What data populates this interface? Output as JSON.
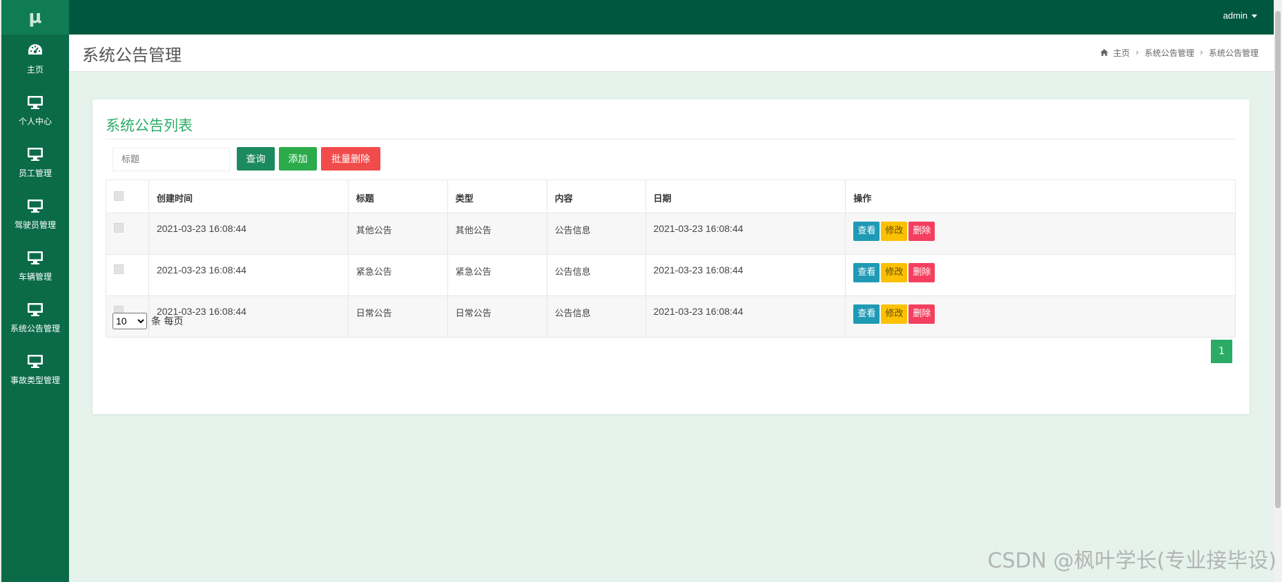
{
  "brand": {
    "logo_text": "μ"
  },
  "topbar": {
    "user": "admin"
  },
  "sidebar": {
    "items": [
      {
        "label": "主页",
        "icon": "dashboard-icon"
      },
      {
        "label": "个人中心",
        "icon": "monitor-icon"
      },
      {
        "label": "员工管理",
        "icon": "monitor-icon"
      },
      {
        "label": "驾驶员管理",
        "icon": "monitor-icon"
      },
      {
        "label": "车辆管理",
        "icon": "monitor-icon"
      },
      {
        "label": "系统公告管理",
        "icon": "monitor-icon"
      },
      {
        "label": "事故类型管理",
        "icon": "monitor-icon"
      }
    ]
  },
  "header": {
    "title": "系统公告管理",
    "breadcrumb": [
      "主页",
      "系统公告管理",
      "系统公告管理"
    ]
  },
  "card": {
    "title": "系统公告列表",
    "search": {
      "placeholder": "标题",
      "value": ""
    },
    "buttons": {
      "query": "查询",
      "add": "添加",
      "batch_delete": "批量删除"
    },
    "table": {
      "headers": [
        "创建时间",
        "标题",
        "类型",
        "内容",
        "日期",
        "操作"
      ],
      "rows": [
        {
          "created": "2021-03-23 16:08:44",
          "title": "其他公告",
          "type": "其他公告",
          "content": "公告信息",
          "date": "2021-03-23 16:08:44"
        },
        {
          "created": "2021-03-23 16:08:44",
          "title": "紧急公告",
          "type": "紧急公告",
          "content": "公告信息",
          "date": "2021-03-23 16:08:44"
        },
        {
          "created": "2021-03-23 16:08:44",
          "title": "日常公告",
          "type": "日常公告",
          "content": "公告信息",
          "date": "2021-03-23 16:08:44"
        }
      ],
      "ops": {
        "view": "查看",
        "edit": "修改",
        "delete": "删除"
      }
    },
    "pager": {
      "size": "10",
      "size_options": [
        "10"
      ],
      "unit_text": "条 每页",
      "current_page": "1"
    }
  },
  "watermark": "CSDN @枫叶学长(专业接毕设)",
  "colors": {
    "topbar": "#00573f",
    "sidebar": "#0b6b49",
    "accent_green": "#2bab66",
    "view": "#1f9ab5",
    "edit": "#fbc102",
    "delete": "#f43f5e",
    "content_bg": "#e6f2ec"
  }
}
